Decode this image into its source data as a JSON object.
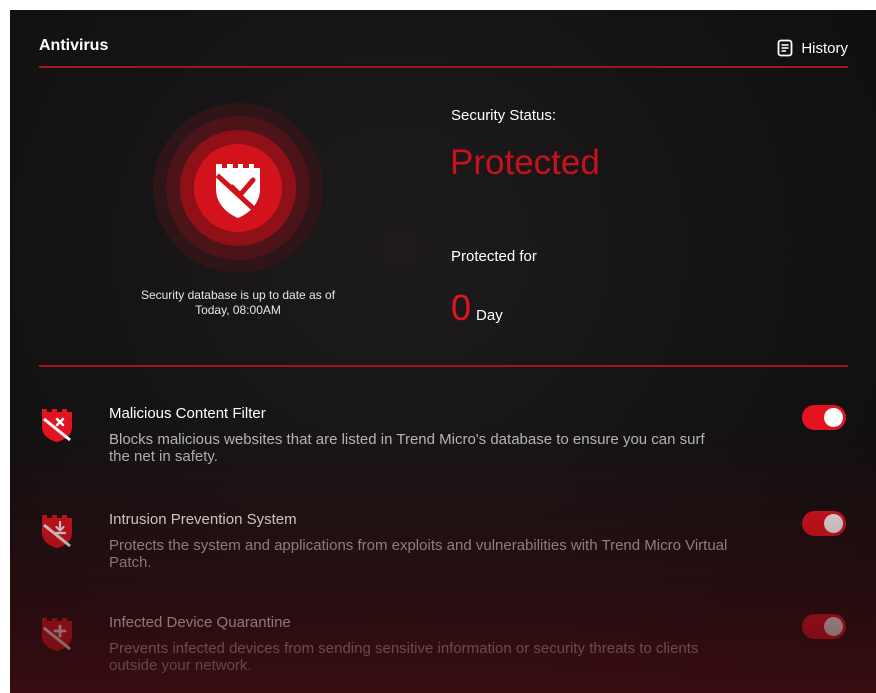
{
  "header": {
    "title": "Antivirus",
    "history_label": "History"
  },
  "status": {
    "db_note": "Security database is up to date as of Today, 08:00AM",
    "security_status_label": "Security Status:",
    "security_status_value": "Protected",
    "protected_for_label": "Protected for",
    "protected_days": "0",
    "protected_unit": "Day"
  },
  "features": [
    {
      "title": "Malicious Content Filter",
      "description": "Blocks malicious websites that are listed in Trend Micro's database to ensure you can surf the net in safety.",
      "enabled": true,
      "icon": "shield-x-icon"
    },
    {
      "title": "Intrusion Prevention System",
      "description": "Protects the system and applications from exploits and vulnerabilities with Trend Micro Virtual Patch.",
      "enabled": true,
      "icon": "shield-download-icon"
    },
    {
      "title": "Infected Device Quarantine",
      "description": "Prevents infected devices from sending sensitive information or security threats to clients outside your network.",
      "enabled": true,
      "icon": "shield-plus-icon"
    }
  ],
  "colors": {
    "accent": "#e3141f",
    "status_red": "#c8121b",
    "divider": "#a3151c",
    "background": "#151314"
  }
}
